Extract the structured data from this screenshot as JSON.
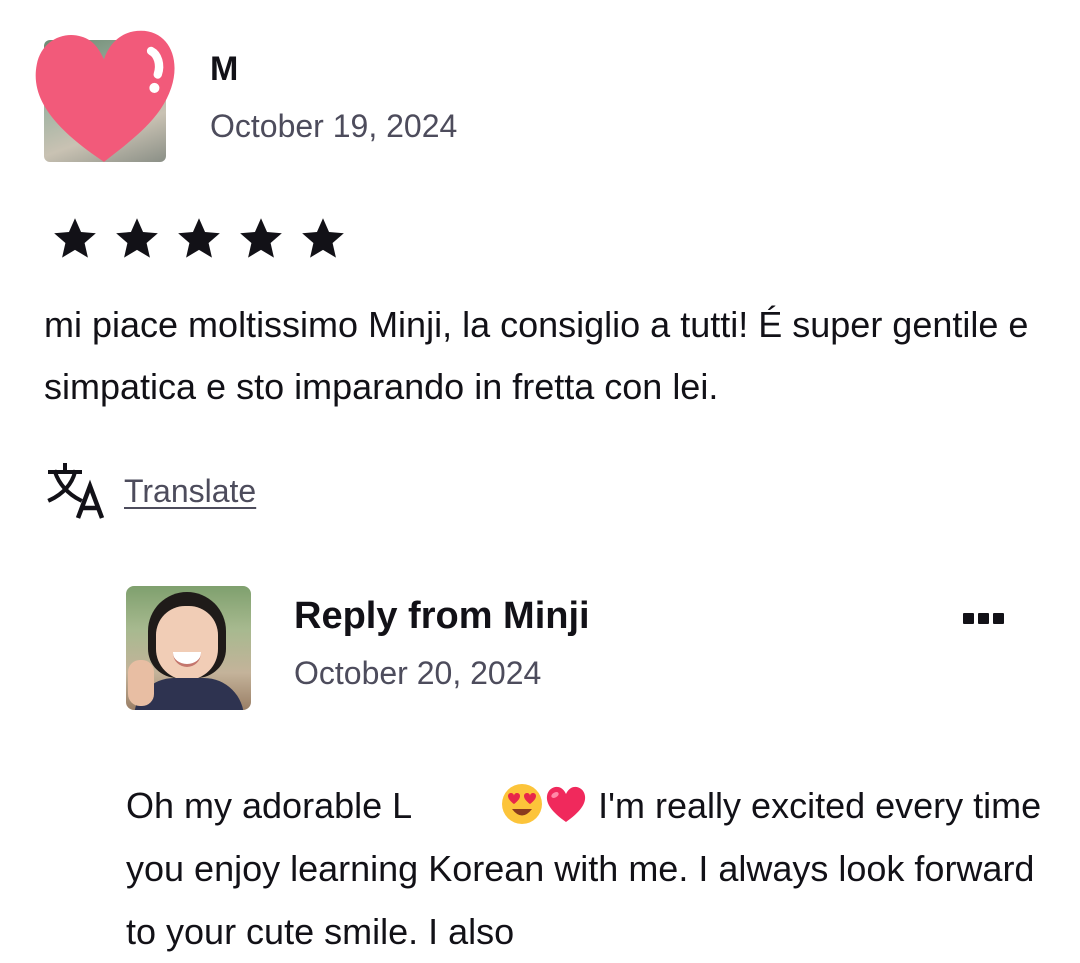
{
  "review": {
    "reviewer_name": "M",
    "date": "October 19, 2024",
    "rating": 5,
    "text": "mi piace moltissimo Minji, la consiglio a tutti! É super gentile e simpatica e sto imparando in fretta con lei.",
    "translate_label": "Translate"
  },
  "reply": {
    "title": "Reply from Minji",
    "date": "October 20, 2024",
    "text_start": "Oh my adorable L",
    "text_rest": " I'm really excited every time you enjoy learning Korean with me. I always look forward to your cute smile. I also"
  },
  "colors": {
    "text": "#121117",
    "muted": "#4d4c5c",
    "heart_sticker": "#f25a7a"
  },
  "icons": {
    "avatar_sticker": "heart-icon",
    "star": "star-icon",
    "translate": "translate-icon",
    "more": "more-options-icon",
    "emoji_1": "heart-eyes-emoji",
    "emoji_2": "red-heart-emoji"
  }
}
